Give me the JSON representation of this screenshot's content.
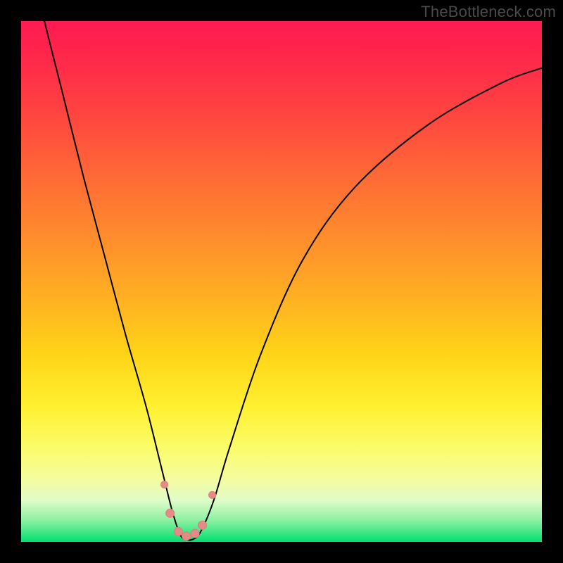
{
  "attribution": "TheBottleneck.com",
  "colors": {
    "top": "#ff1a52",
    "mid": "#ffd418",
    "bottom": "#00e070",
    "curve": "#000000",
    "dot": "#e58a86"
  },
  "chart_data": {
    "type": "line",
    "title": "",
    "xlabel": "",
    "ylabel": "",
    "xlim": [
      0,
      100
    ],
    "ylim": [
      0,
      100
    ],
    "series": [
      {
        "name": "bottleneck-curve",
        "x": [
          0,
          4,
          8,
          12,
          16,
          20,
          24,
          27,
          29,
          30.5,
          31.5,
          33,
          34.5,
          37,
          40,
          46,
          54,
          64,
          78,
          92,
          100
        ],
        "y": [
          120,
          102,
          86,
          70,
          55,
          40,
          26,
          14,
          6,
          1.5,
          0.5,
          0.5,
          2,
          8,
          18,
          36,
          54,
          68,
          80,
          88,
          91
        ]
      }
    ],
    "markers": [
      {
        "x": 27.5,
        "y": 11,
        "r": 5
      },
      {
        "x": 28.6,
        "y": 5.5,
        "r": 6
      },
      {
        "x": 30.2,
        "y": 2.0,
        "r": 6
      },
      {
        "x": 31.7,
        "y": 1.1,
        "r": 6
      },
      {
        "x": 33.4,
        "y": 1.6,
        "r": 6
      },
      {
        "x": 34.8,
        "y": 3.2,
        "r": 6
      },
      {
        "x": 36.7,
        "y": 9.0,
        "r": 5
      }
    ]
  }
}
